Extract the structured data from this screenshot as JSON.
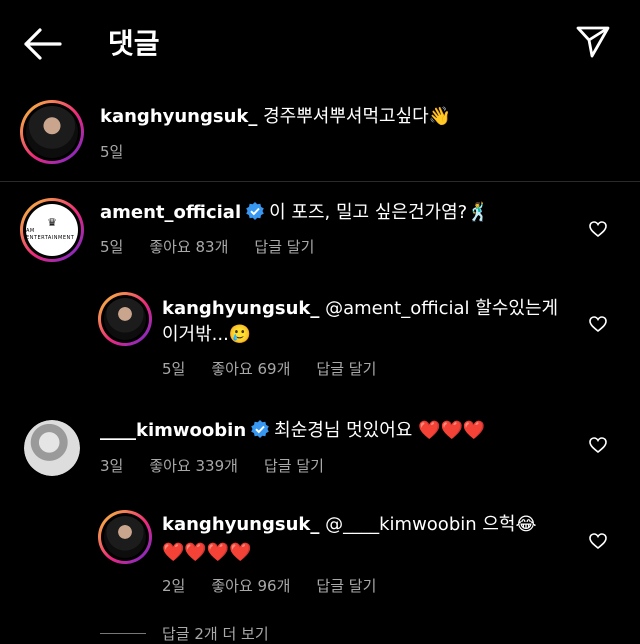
{
  "header": {
    "title": "댓글"
  },
  "caption": {
    "username": "kanghyungsuk_",
    "text": " 경주뿌셔뿌셔먹고싶다👋",
    "time": "5일"
  },
  "comments": [
    {
      "username": "ament_official",
      "text": "이 포즈, 밀고 싶은건가염?🕺",
      "time": "5일",
      "likes": "좋아요 83개",
      "reply_label": "답글 달기"
    },
    {
      "username": "kanghyungsuk_",
      "line1": " @ament_official 할수있는게",
      "line2": "이거밖...🥲",
      "time": "5일",
      "likes": "좋아요 69개",
      "reply_label": "답글 달기"
    },
    {
      "username": "____kimwoobin",
      "text": "최순경님 멋있어요 ❤️❤️❤️",
      "time": "3일",
      "likes": "좋아요 339개",
      "reply_label": "답글 달기"
    },
    {
      "username": "kanghyungsuk_",
      "line1": " @____kimwoobin 으헉😂",
      "line2": "❤️❤️❤️❤️",
      "time": "2일",
      "likes": "좋아요 96개",
      "reply_label": "답글 달기"
    }
  ],
  "more_replies": "답글 2개 더 보기",
  "logo_text": "AM ENTERTAINMENT",
  "colors": {
    "background": "#000000",
    "meta": "#a8a8a8",
    "verified": "#3897f0"
  }
}
